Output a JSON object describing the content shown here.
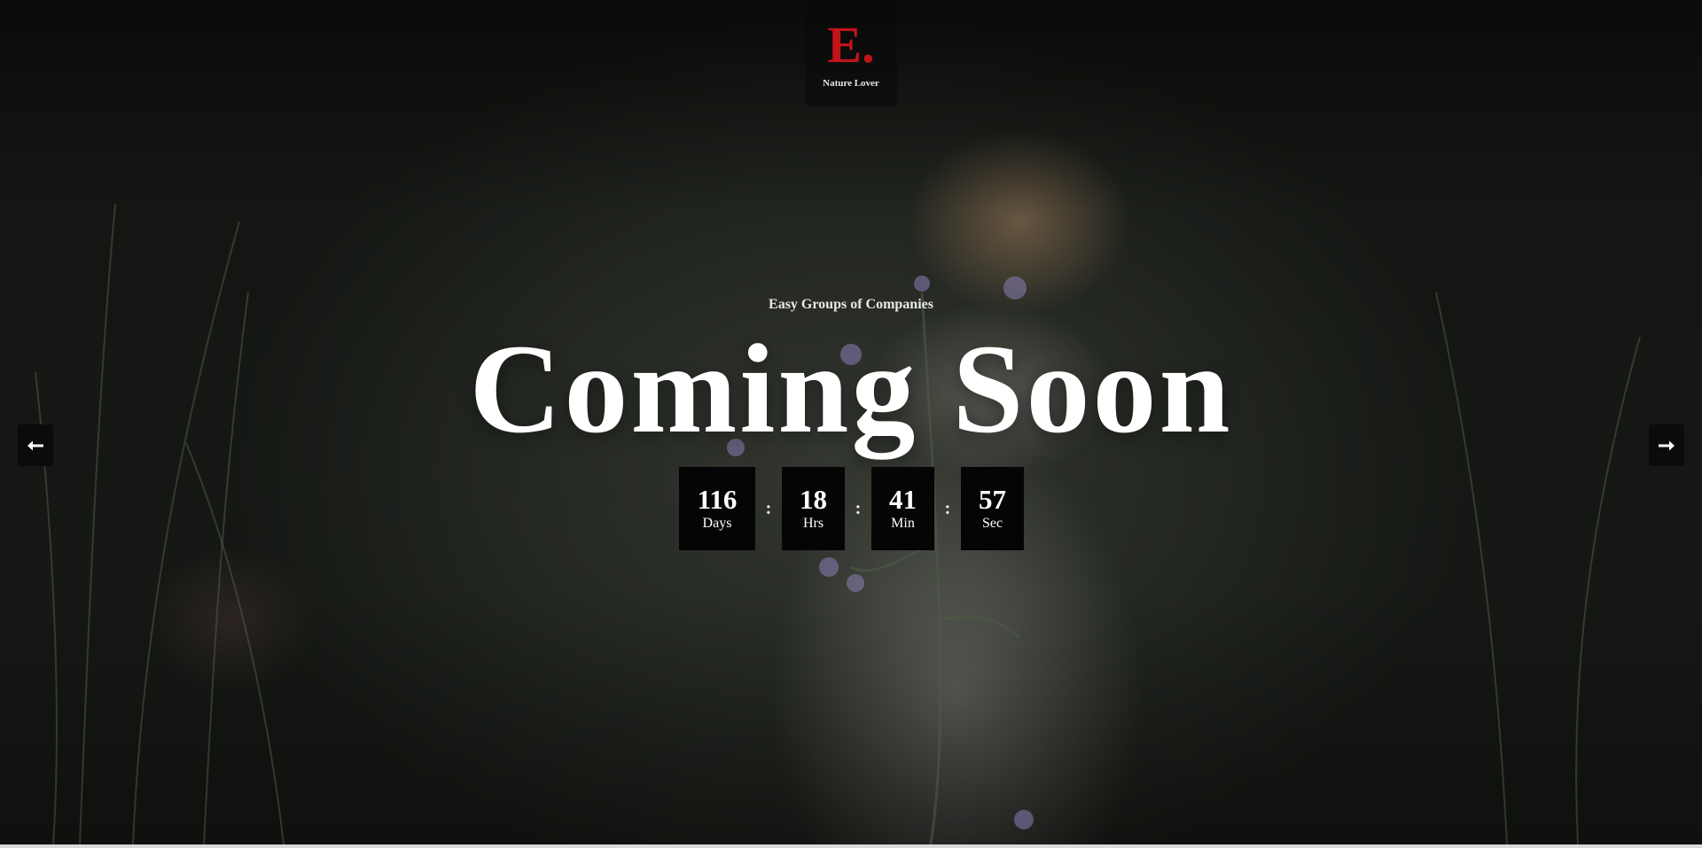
{
  "logo": {
    "mark": "E.",
    "subtitle": "Nature Lover"
  },
  "hero": {
    "tagline": "Easy Groups of Companies",
    "headline": "Coming Soon"
  },
  "countdown": {
    "days": {
      "value": "116",
      "label": "Days"
    },
    "hours": {
      "value": "18",
      "label": "Hrs"
    },
    "minutes": {
      "value": "41",
      "label": "Min"
    },
    "seconds": {
      "value": "57",
      "label": "Sec"
    },
    "separator": ":"
  },
  "slider": {
    "prev_icon": "arrow-left-icon",
    "next_icon": "arrow-right-icon"
  },
  "colors": {
    "brand": "#c3141b",
    "countdown_bg": "#050505",
    "text": "#ffffff"
  }
}
